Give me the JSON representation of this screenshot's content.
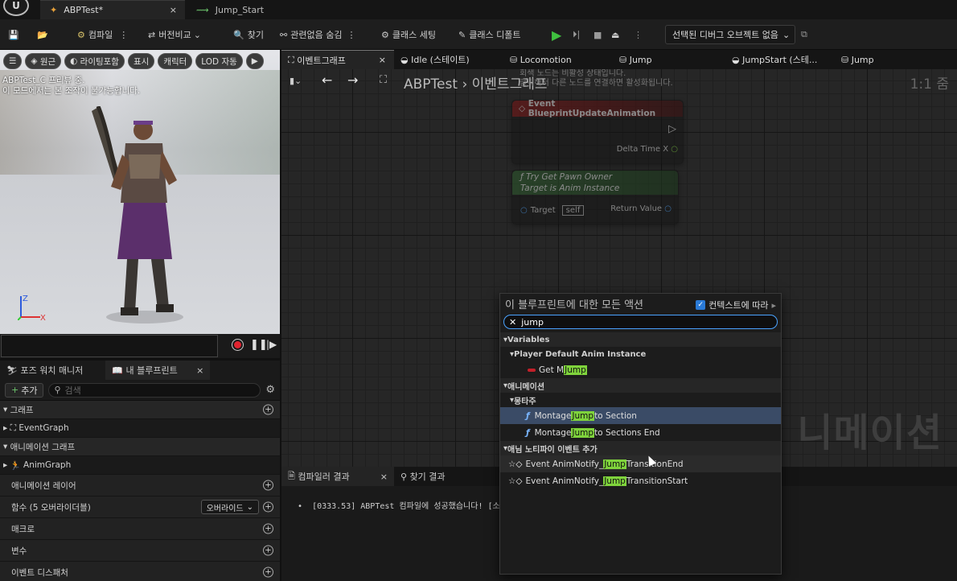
{
  "titlebar": {
    "tabs": [
      {
        "label": "ABPTest*",
        "icon": "anim-blueprint-icon"
      },
      {
        "label": "Jump_Start",
        "icon": "anim-sequence-icon"
      }
    ]
  },
  "toolbar": {
    "compile": "컴파일",
    "diff": "버전비교",
    "find": "찾기",
    "hide_unrelated": "관련없음 숨김",
    "class_settings": "클래스 세팅",
    "class_defaults": "클래스 디폴트",
    "debug_object": "선택된 디버그 오브젝트 없음"
  },
  "viewport": {
    "buttons": [
      "원근",
      "라이팅포함",
      "표시",
      "캐릭터",
      "LOD 자동"
    ],
    "info_line1": "ABPTest_C 프리뷰 중.",
    "info_line2": "이 모드에서는 본 조작이 불가능합니다.",
    "axis_z": "Z",
    "axis_x": "X"
  },
  "leftpanel": {
    "tabs": [
      "포즈 워치 매니저",
      "내 블루프린트"
    ],
    "add_label": "추가",
    "search_placeholder": "검색",
    "rows": {
      "graph": "그래프",
      "eventgraph": "EventGraph",
      "anim_graph_sec": "애니메이션 그래프",
      "animgraph": "AnimGraph",
      "anim_layer": "애니메이션 레이어",
      "functions": "함수 (5 오버라이더블)",
      "override": "오버라이드",
      "macros": "매크로",
      "variables": "변수",
      "dispatchers": "이벤트 디스패처"
    }
  },
  "graph": {
    "tabs": [
      "이벤트그래프",
      "Idle (스테이트)",
      "Locomotion",
      "Jump",
      "JumpStart (스테...",
      "Jump"
    ],
    "breadcrumb_root": "ABPTest",
    "breadcrumb_sep": "›",
    "breadcrumb_current": "이벤트그래프",
    "zoom": "1:1 줌",
    "hint_line1": "회색 노드는 비활성 상태입니다.",
    "hint_line2": "클릭해서 다른 노드를 연결하면 활성화됩니다.",
    "watermark": "니메이션",
    "node1": {
      "title": "Event BlueprintUpdateAnimation",
      "pin": "Delta Time X"
    },
    "node2": {
      "title": "Try Get Pawn Owner",
      "subtitle": "Target is Anim Instance",
      "target_label": "Target",
      "target_value": "self",
      "return_label": "Return Value"
    }
  },
  "results": {
    "tabs": [
      "컴파일러 결과",
      "찾기 결과"
    ],
    "log": "[0333.53] ABPTest 컴파일에 성공했습니다! [소"
  },
  "context_menu": {
    "title": "이 블루프린트에 대한 모든 액션",
    "context_label": "컨텍스트에 따라",
    "search_value": "jump",
    "items": [
      {
        "kind": "cat",
        "label": "Variables"
      },
      {
        "kind": "sub",
        "label": "Player Default Anim Instance"
      },
      {
        "kind": "var",
        "pre": "Get M ",
        "hl": "Jump",
        "post": ""
      },
      {
        "kind": "cat",
        "label": "애니메이션"
      },
      {
        "kind": "sub",
        "label": "몽타주"
      },
      {
        "kind": "fn",
        "pre": "Montage ",
        "hl": "Jump",
        "post": " to Section",
        "selected": true
      },
      {
        "kind": "fn",
        "pre": "Montage ",
        "hl": "Jump",
        "post": " to Sections End"
      },
      {
        "kind": "cat",
        "label": "애님 노티파이 이벤트 추가"
      },
      {
        "kind": "ev",
        "pre": "Event AnimNotify_",
        "hl": "Jump",
        "post": "TransitionEnd",
        "hover": true
      },
      {
        "kind": "ev",
        "pre": "Event AnimNotify_",
        "hl": "Jump",
        "post": "TransitionStart"
      }
    ]
  },
  "colors": {
    "highlight": "#7fd33c",
    "selection": "#3a4b66",
    "play": "#3fbf3f",
    "record": "#e0232f"
  }
}
